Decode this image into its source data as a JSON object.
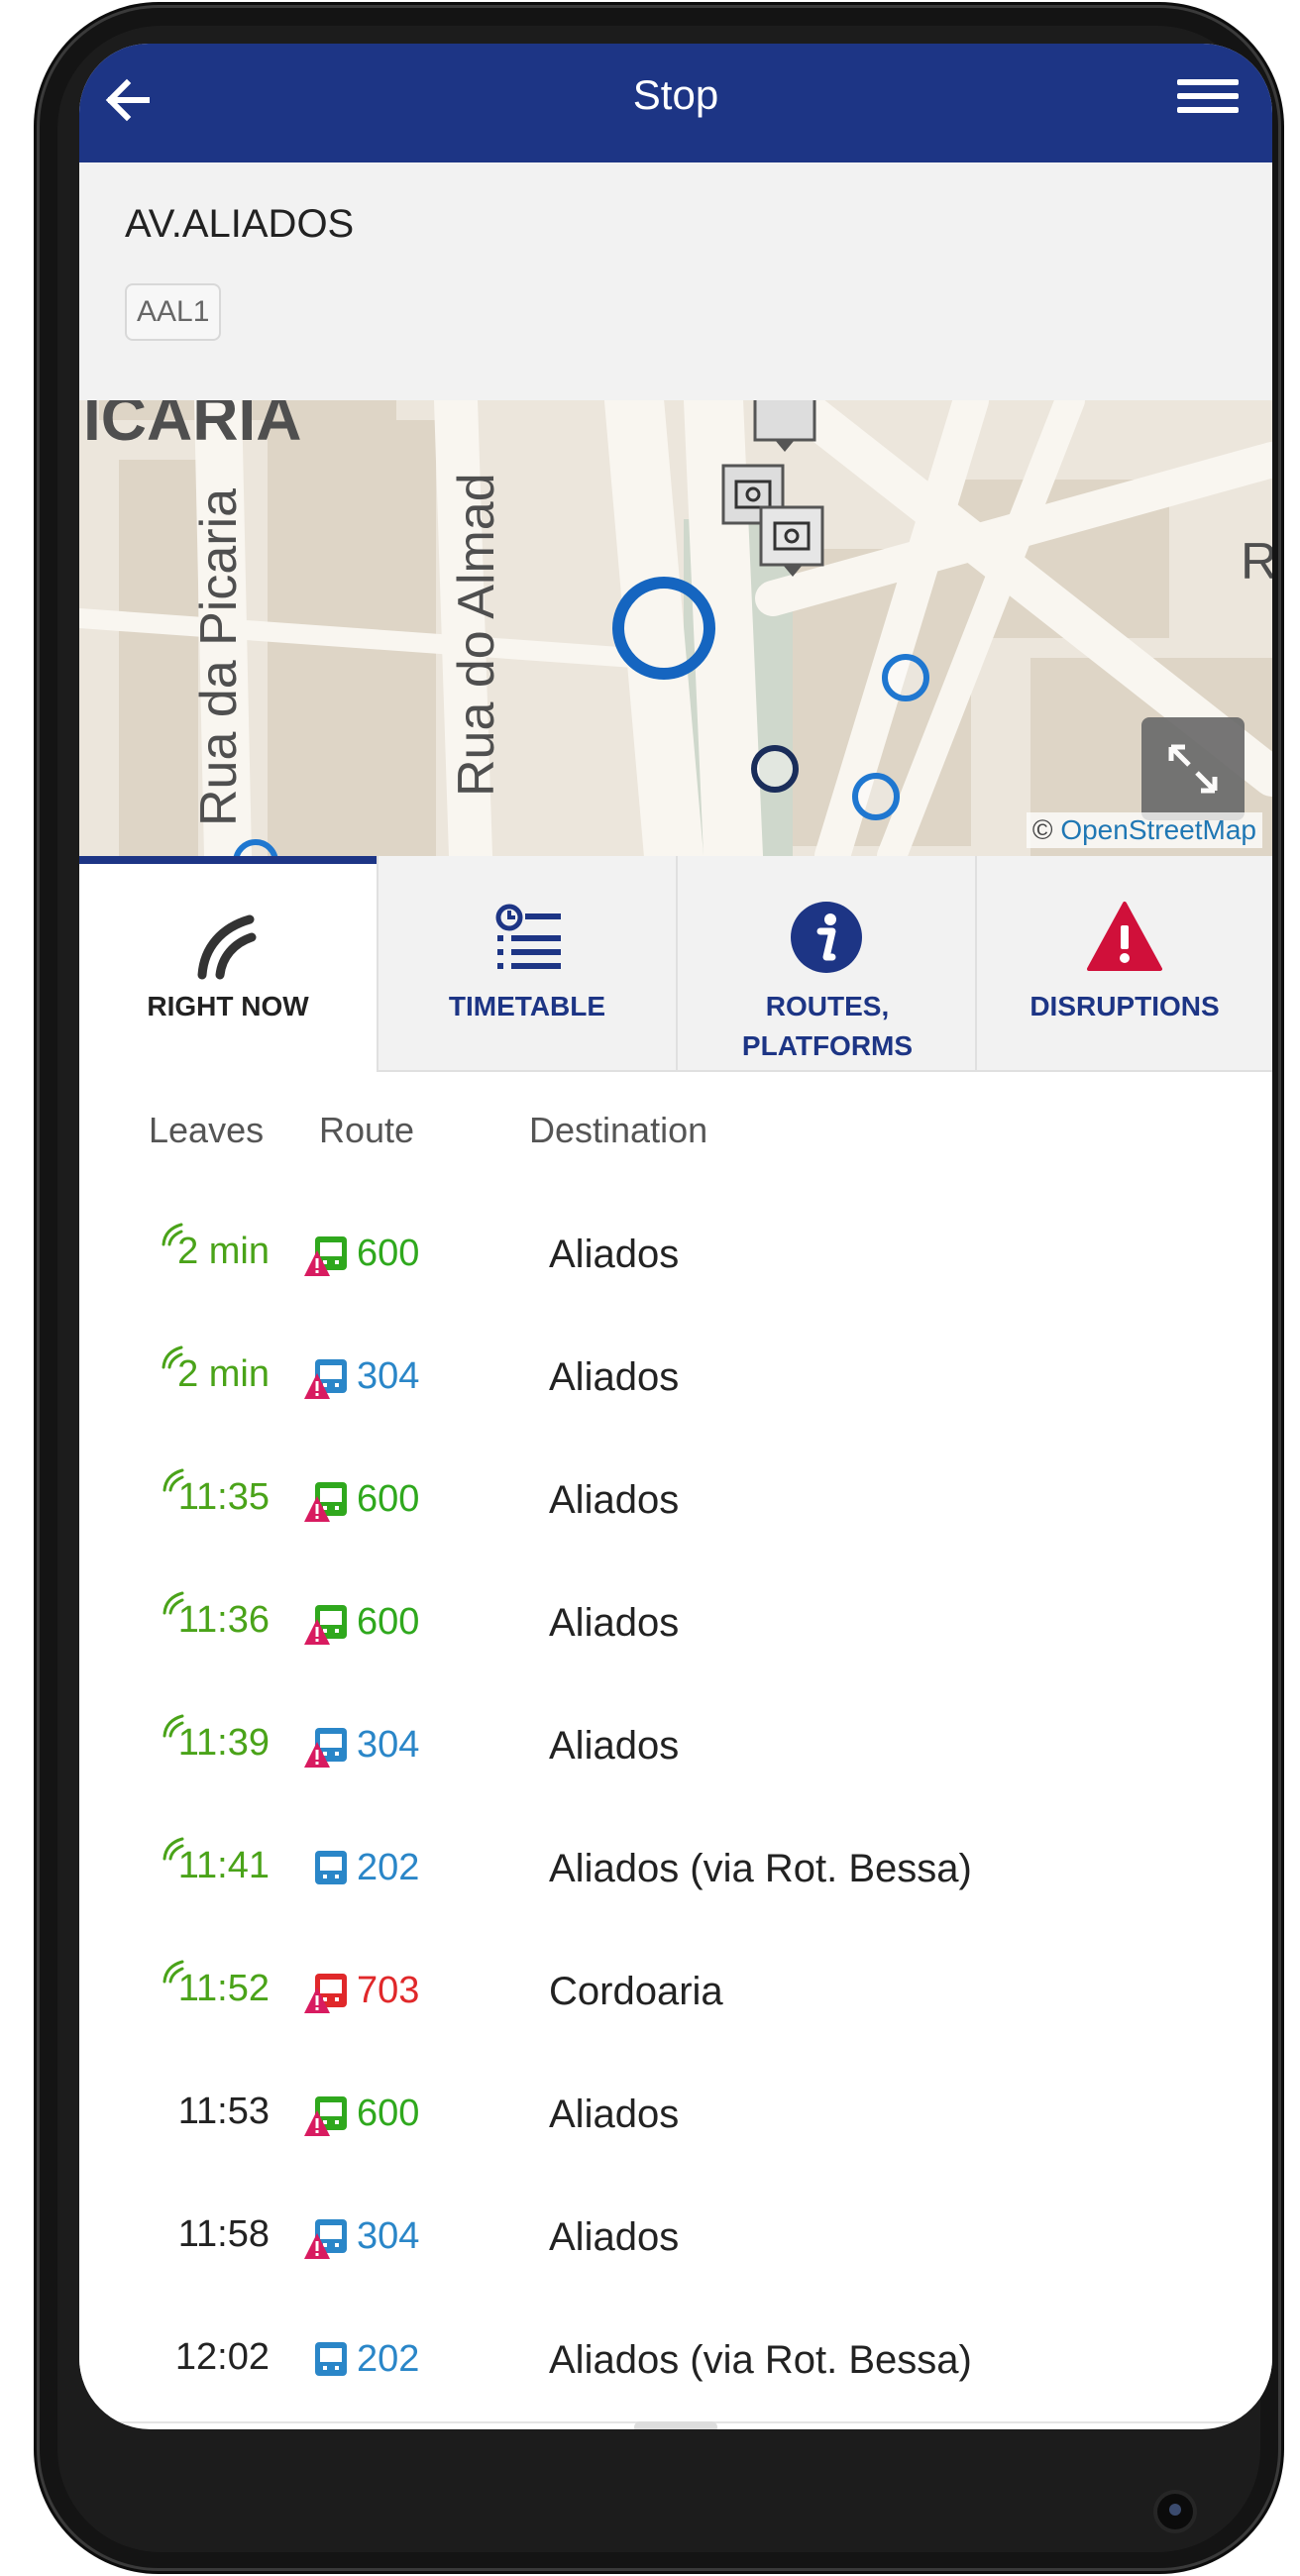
{
  "header": {
    "title": "Stop"
  },
  "stop": {
    "name": "AV.ALIADOS",
    "code": "AAL1"
  },
  "map": {
    "labels": [
      "ICARIA",
      "Rua da Picaria",
      "Rua do Almad",
      "R"
    ],
    "attribution_prefix": "©",
    "attribution_link": "OpenStreetMap"
  },
  "tabs": [
    {
      "label": "RIGHT NOW",
      "icon": "realtime-signal-icon",
      "active": true
    },
    {
      "label": "TIMETABLE",
      "icon": "timetable-icon",
      "active": false
    },
    {
      "label": "ROUTES, PLATFORMS",
      "icon": "info-icon",
      "active": false
    },
    {
      "label": "DISRUPTIONS",
      "icon": "warning-icon",
      "active": false
    }
  ],
  "table": {
    "headers": {
      "leaves": "Leaves",
      "route": "Route",
      "destination": "Destination"
    },
    "rows": [
      {
        "leaves": "2 min",
        "realtime": true,
        "route": "600",
        "color": "#2fa81d",
        "alert": true,
        "destination": "Aliados"
      },
      {
        "leaves": "2 min",
        "realtime": true,
        "route": "304",
        "color": "#2a86c8",
        "alert": true,
        "destination": "Aliados"
      },
      {
        "leaves": "11:35",
        "realtime": true,
        "route": "600",
        "color": "#2fa81d",
        "alert": true,
        "destination": "Aliados"
      },
      {
        "leaves": "11:36",
        "realtime": true,
        "route": "600",
        "color": "#2fa81d",
        "alert": true,
        "destination": "Aliados"
      },
      {
        "leaves": "11:39",
        "realtime": true,
        "route": "304",
        "color": "#2a86c8",
        "alert": true,
        "destination": "Aliados"
      },
      {
        "leaves": "11:41",
        "realtime": true,
        "route": "202",
        "color": "#2a86c8",
        "alert": false,
        "destination": "Aliados (via Rot. Bessa)"
      },
      {
        "leaves": "11:52",
        "realtime": true,
        "route": "703",
        "color": "#e0282a",
        "alert": true,
        "destination": "Cordoaria"
      },
      {
        "leaves": "11:53",
        "realtime": false,
        "route": "600",
        "color": "#2fa81d",
        "alert": true,
        "destination": "Aliados"
      },
      {
        "leaves": "11:58",
        "realtime": false,
        "route": "304",
        "color": "#2a86c8",
        "alert": true,
        "destination": "Aliados"
      },
      {
        "leaves": "12:02",
        "realtime": false,
        "route": "202",
        "color": "#2a86c8",
        "alert": false,
        "destination": "Aliados (via Rot. Bessa)"
      }
    ]
  },
  "colors": {
    "header_bg": "#1d3585",
    "realtime_green": "#4aa319",
    "alert_red": "#d81b60",
    "warning_red": "#d0103a"
  }
}
